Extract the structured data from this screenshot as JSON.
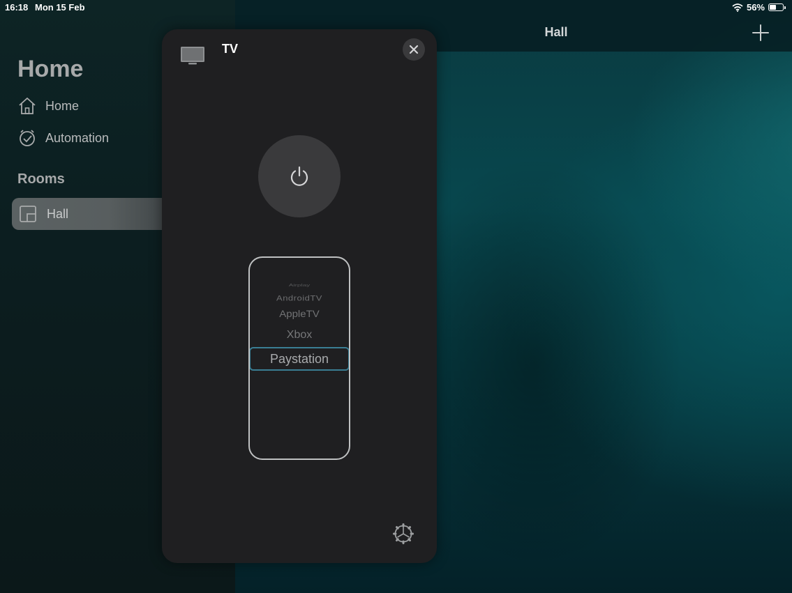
{
  "status_bar": {
    "time": "16:18",
    "date": "Mon 15 Feb",
    "battery": "56%"
  },
  "sidebar": {
    "title": "Home",
    "items": [
      {
        "label": "Home",
        "icon": "house-icon"
      },
      {
        "label": "Automation",
        "icon": "clock-check-icon"
      }
    ],
    "rooms_heading": "Rooms",
    "rooms": [
      {
        "label": "Hall",
        "icon": "room-icon",
        "selected": true
      }
    ]
  },
  "main": {
    "title": "Hall",
    "add_icon": "plus-icon"
  },
  "modal": {
    "title": "TV",
    "device_icon": "tv-icon",
    "close_icon": "close-icon",
    "power_icon": "power-icon",
    "settings_icon": "gear-icon",
    "source_picker": {
      "options": [
        "Airplay",
        "AndroidTV",
        "AppleTV",
        "Xbox",
        "Paystation"
      ],
      "selected": "Paystation"
    }
  },
  "colors": {
    "accent": "#3a7e94",
    "modal_bg": "#1f1f21"
  }
}
